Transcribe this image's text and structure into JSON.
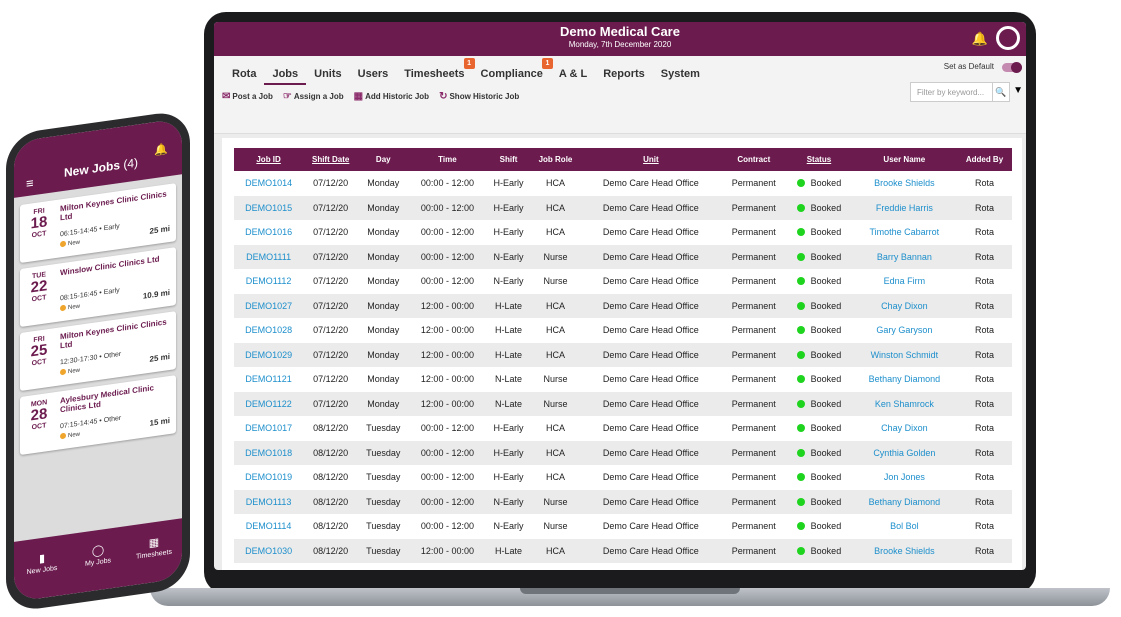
{
  "app": {
    "title": "Demo Medical Care",
    "date": "Monday, 7th December 2020"
  },
  "icons": {
    "bell": "bell-icon",
    "avatar": "user-avatar-icon",
    "filter": "funnel-icon",
    "search": "search-icon"
  },
  "colors": {
    "brand": "#6b1b4e",
    "link": "#1d8fcc",
    "booked": "#1fd41f",
    "badge": "#e8652f"
  },
  "nav": {
    "tabs": [
      {
        "label": "Rota",
        "badge": ""
      },
      {
        "label": "Jobs",
        "badge": ""
      },
      {
        "label": "Units",
        "badge": ""
      },
      {
        "label": "Users",
        "badge": ""
      },
      {
        "label": "Timesheets",
        "badge": "1"
      },
      {
        "label": "Compliance",
        "badge": "1"
      },
      {
        "label": "A & L",
        "badge": ""
      },
      {
        "label": "Reports",
        "badge": ""
      },
      {
        "label": "System",
        "badge": ""
      }
    ],
    "active_tab": "Jobs",
    "set_default_label": "Set as Default",
    "filter_placeholder": "Filter by keyword...",
    "actions": [
      "Post a Job",
      "Assign a Job",
      "Add Historic Job",
      "Show Historic Job"
    ]
  },
  "table": {
    "headers": [
      "Job ID",
      "Shift Date",
      "Day",
      "Time",
      "Shift",
      "Job Role",
      "Unit",
      "Contract",
      "Status",
      "User Name",
      "Added By"
    ],
    "rows": [
      [
        "DEMO1014",
        "07/12/20",
        "Monday",
        "00:00 - 12:00",
        "H-Early",
        "HCA",
        "Demo Care Head Office",
        "Permanent",
        "Booked",
        "Brooke Shields",
        "Rota"
      ],
      [
        "DEMO1015",
        "07/12/20",
        "Monday",
        "00:00 - 12:00",
        "H-Early",
        "HCA",
        "Demo Care Head Office",
        "Permanent",
        "Booked",
        "Freddie Harris",
        "Rota"
      ],
      [
        "DEMO1016",
        "07/12/20",
        "Monday",
        "00:00 - 12:00",
        "H-Early",
        "HCA",
        "Demo Care Head Office",
        "Permanent",
        "Booked",
        "Timothe Cabarrot",
        "Rota"
      ],
      [
        "DEMO1111",
        "07/12/20",
        "Monday",
        "00:00 - 12:00",
        "N-Early",
        "Nurse",
        "Demo Care Head Office",
        "Permanent",
        "Booked",
        "Barry Bannan",
        "Rota"
      ],
      [
        "DEMO1112",
        "07/12/20",
        "Monday",
        "00:00 - 12:00",
        "N-Early",
        "Nurse",
        "Demo Care Head Office",
        "Permanent",
        "Booked",
        "Edna Firm",
        "Rota"
      ],
      [
        "DEMO1027",
        "07/12/20",
        "Monday",
        "12:00 - 00:00",
        "H-Late",
        "HCA",
        "Demo Care Head Office",
        "Permanent",
        "Booked",
        "Chay Dixon",
        "Rota"
      ],
      [
        "DEMO1028",
        "07/12/20",
        "Monday",
        "12:00 - 00:00",
        "H-Late",
        "HCA",
        "Demo Care Head Office",
        "Permanent",
        "Booked",
        "Gary Garyson",
        "Rota"
      ],
      [
        "DEMO1029",
        "07/12/20",
        "Monday",
        "12:00 - 00:00",
        "H-Late",
        "HCA",
        "Demo Care Head Office",
        "Permanent",
        "Booked",
        "Winston Schmidt",
        "Rota"
      ],
      [
        "DEMO1121",
        "07/12/20",
        "Monday",
        "12:00 - 00:00",
        "N-Late",
        "Nurse",
        "Demo Care Head Office",
        "Permanent",
        "Booked",
        "Bethany Diamond",
        "Rota"
      ],
      [
        "DEMO1122",
        "07/12/20",
        "Monday",
        "12:00 - 00:00",
        "N-Late",
        "Nurse",
        "Demo Care Head Office",
        "Permanent",
        "Booked",
        "Ken Shamrock",
        "Rota"
      ],
      [
        "DEMO1017",
        "08/12/20",
        "Tuesday",
        "00:00 - 12:00",
        "H-Early",
        "HCA",
        "Demo Care Head Office",
        "Permanent",
        "Booked",
        "Chay Dixon",
        "Rota"
      ],
      [
        "DEMO1018",
        "08/12/20",
        "Tuesday",
        "00:00 - 12:00",
        "H-Early",
        "HCA",
        "Demo Care Head Office",
        "Permanent",
        "Booked",
        "Cynthia Golden",
        "Rota"
      ],
      [
        "DEMO1019",
        "08/12/20",
        "Tuesday",
        "00:00 - 12:00",
        "H-Early",
        "HCA",
        "Demo Care Head Office",
        "Permanent",
        "Booked",
        "Jon Jones",
        "Rota"
      ],
      [
        "DEMO1113",
        "08/12/20",
        "Tuesday",
        "00:00 - 12:00",
        "N-Early",
        "Nurse",
        "Demo Care Head Office",
        "Permanent",
        "Booked",
        "Bethany Diamond",
        "Rota"
      ],
      [
        "DEMO1114",
        "08/12/20",
        "Tuesday",
        "00:00 - 12:00",
        "N-Early",
        "Nurse",
        "Demo Care Head Office",
        "Permanent",
        "Booked",
        "Bol Bol",
        "Rota"
      ],
      [
        "DEMO1030",
        "08/12/20",
        "Tuesday",
        "12:00 - 00:00",
        "H-Late",
        "HCA",
        "Demo Care Head Office",
        "Permanent",
        "Booked",
        "Brooke Shields",
        "Rota"
      ]
    ]
  },
  "phone": {
    "title": "New Jobs",
    "count": "(4)",
    "cards": [
      {
        "dow": "FRI",
        "day": "18",
        "mon": "OCT",
        "name": "Milton Keynes Clinic Clinics Ltd",
        "time": "06:15-14:45 • Early",
        "status": "New",
        "dist": "25 mi"
      },
      {
        "dow": "TUE",
        "day": "22",
        "mon": "OCT",
        "name": "Winslow Clinic Clinics Ltd",
        "time": "08:15-16:45 • Early",
        "status": "New",
        "dist": "10.9 mi"
      },
      {
        "dow": "FRI",
        "day": "25",
        "mon": "OCT",
        "name": "Milton Keynes Clinic Clinics Ltd",
        "time": "12:30-17:30 • Other",
        "status": "New",
        "dist": "25 mi"
      },
      {
        "dow": "MON",
        "day": "28",
        "mon": "OCT",
        "name": "Aylesbury Medical Clinic Clinics Ltd",
        "time": "07:15-14:45 • Other",
        "status": "New",
        "dist": "15 mi"
      }
    ],
    "footer": [
      "New Jobs",
      "My Jobs",
      "Timesheets"
    ]
  }
}
